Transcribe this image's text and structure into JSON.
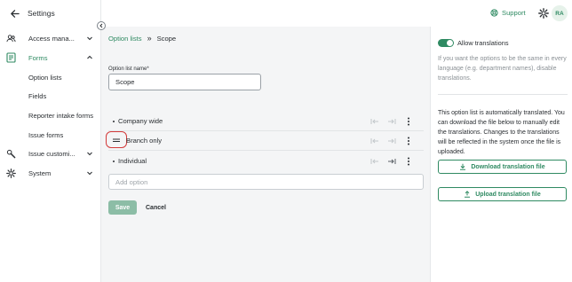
{
  "sidebar": {
    "title": "Settings",
    "items": [
      {
        "label": "Access mana...",
        "icon": "users-icon"
      },
      {
        "label": "Forms",
        "icon": "document-icon"
      },
      {
        "label": "Option lists"
      },
      {
        "label": "Fields"
      },
      {
        "label": "Reporter intake forms"
      },
      {
        "label": "Issue forms"
      },
      {
        "label": "Issue customi...",
        "icon": "wrench-icon"
      },
      {
        "label": "System",
        "icon": "gear-icon"
      }
    ]
  },
  "topbar": {
    "support_label": "Support",
    "avatar_initials": "RA"
  },
  "breadcrumb": {
    "parent": "Option lists",
    "separator": "»",
    "current": "Scope"
  },
  "form": {
    "name_label": "Option list name*",
    "name_value": "Scope",
    "options": [
      "Company wide",
      "Branch only",
      "Individual"
    ],
    "add_placeholder": "Add option",
    "save_label": "Save",
    "cancel_label": "Cancel"
  },
  "translations": {
    "toggle_label": "Allow translations",
    "toggle_on": true,
    "hint": "If you want the options to be the same in every language (e.g. department names), disable translations.",
    "info": "This option list is automatically translated. You can download the file below to manually edit the translations. Changes to the translations will be reflected in the system once the file is uploaded.",
    "download_label": "Download translation file",
    "upload_label": "Upload translation file"
  },
  "colors": {
    "accent": "#2f8a62",
    "highlight": "#d33a3a"
  }
}
